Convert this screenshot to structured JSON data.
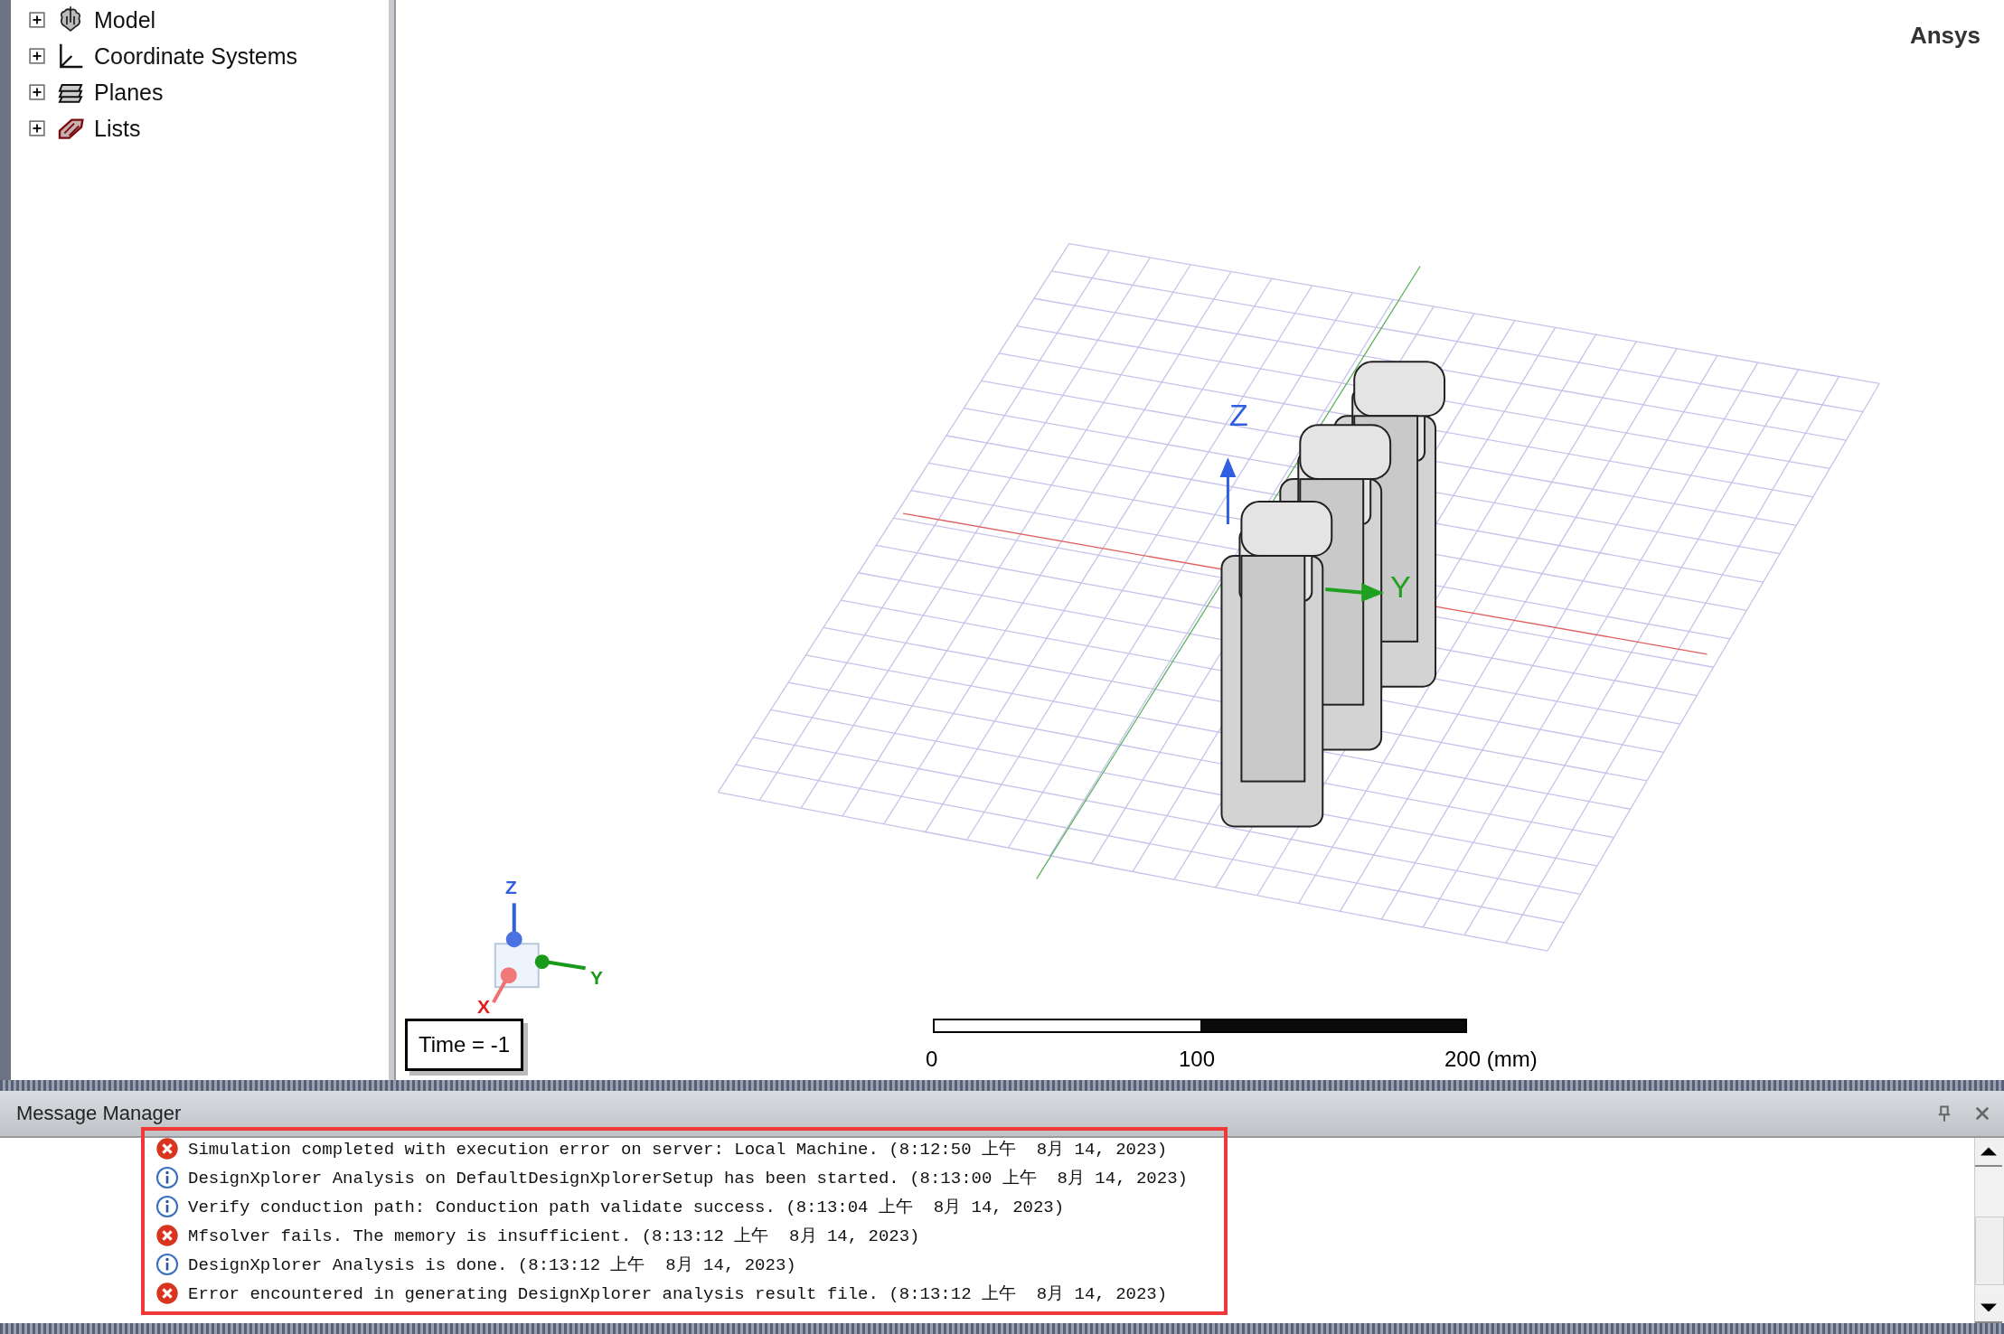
{
  "tree": {
    "items": [
      {
        "label": "Model",
        "expanded": false
      },
      {
        "label": "Coordinate Systems",
        "expanded": false
      },
      {
        "label": "Planes",
        "expanded": false
      },
      {
        "label": "Lists",
        "expanded": false
      }
    ]
  },
  "viewport": {
    "brand": "Ansys",
    "axis_labels": {
      "z": "Z",
      "y": "Y"
    },
    "triad_labels": {
      "z": "Z",
      "y": "Y",
      "x": "X"
    },
    "time_label": "Time = -1",
    "scale_labels": [
      "0",
      "100",
      "200 (mm)"
    ]
  },
  "message_manager": {
    "title": "Message Manager",
    "messages": [
      {
        "kind": "error",
        "text": "Simulation completed with execution error on server: Local Machine. (8:12:50 上午  8月 14, 2023)"
      },
      {
        "kind": "info",
        "text": "DesignXplorer Analysis on DefaultDesignXplorerSetup has been started. (8:13:00 上午  8月 14, 2023)"
      },
      {
        "kind": "info",
        "text": "Verify conduction path: Conduction path validate success. (8:13:04 上午  8月 14, 2023)"
      },
      {
        "kind": "error",
        "text": "Mfsolver fails. The memory is insufficient. (8:13:12 上午  8月 14, 2023)"
      },
      {
        "kind": "info",
        "text": "DesignXplorer Analysis is done. (8:13:12 上午  8月 14, 2023)"
      },
      {
        "kind": "error",
        "text": "Error encountered in generating DesignXplorer analysis result file. (8:13:12 上午  8月 14, 2023)"
      }
    ]
  }
}
